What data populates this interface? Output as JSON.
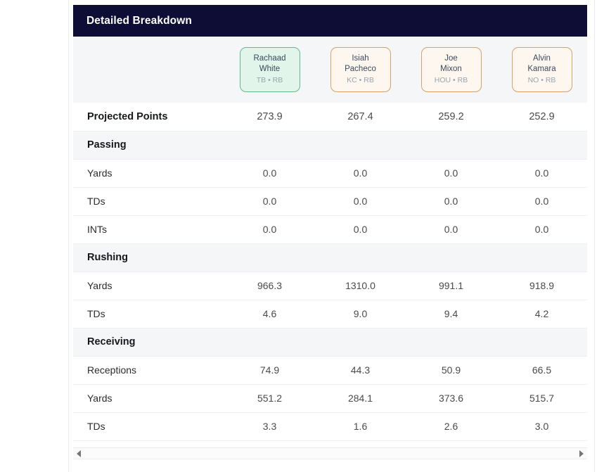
{
  "card": {
    "title": "Detailed Breakdown"
  },
  "scrollbar": {
    "left_arrow": "left-arrow-icon",
    "right_arrow": "right-arrow-icon"
  },
  "players": [
    {
      "first_name": "Rachaad",
      "last_name": "White",
      "team": "TB",
      "position": "RB",
      "meta": "TB • RB",
      "accent": "green",
      "accent_color": "#63b98d"
    },
    {
      "first_name": "Isiah",
      "last_name": "Pacheco",
      "team": "KC",
      "position": "RB",
      "meta": "KC • RB",
      "accent": "orange",
      "accent_color": "#d6a267"
    },
    {
      "first_name": "Joe",
      "last_name": "Mixon",
      "team": "HOU",
      "position": "RB",
      "meta": "HOU • RB",
      "accent": "orange",
      "accent_color": "#d6a267"
    },
    {
      "first_name": "Alvin",
      "last_name": "Kamara",
      "team": "NO",
      "position": "RB",
      "meta": "NO • RB",
      "accent": "orange",
      "accent_color": "#d6a267"
    }
  ],
  "chart_data": {
    "type": "table",
    "title": "Detailed Breakdown",
    "columns": [
      "",
      "Rachaad White",
      "Isiah Pacheco",
      "Joe Mixon",
      "Alvin Kamara"
    ],
    "rows": [
      {
        "kind": "stat",
        "label": "Projected Points",
        "emphasis": true,
        "values": [
          "273.9",
          "267.4",
          "259.2",
          "252.9"
        ]
      },
      {
        "kind": "section",
        "label": "Passing",
        "values": []
      },
      {
        "kind": "stat",
        "label": "Yards",
        "emphasis": false,
        "values": [
          "0.0",
          "0.0",
          "0.0",
          "0.0"
        ]
      },
      {
        "kind": "stat",
        "label": "TDs",
        "emphasis": false,
        "values": [
          "0.0",
          "0.0",
          "0.0",
          "0.0"
        ]
      },
      {
        "kind": "stat",
        "label": "INTs",
        "emphasis": false,
        "values": [
          "0.0",
          "0.0",
          "0.0",
          "0.0"
        ]
      },
      {
        "kind": "section",
        "label": "Rushing",
        "values": []
      },
      {
        "kind": "stat",
        "label": "Yards",
        "emphasis": false,
        "values": [
          "966.3",
          "1310.0",
          "991.1",
          "918.9"
        ]
      },
      {
        "kind": "stat",
        "label": "TDs",
        "emphasis": false,
        "values": [
          "4.6",
          "9.0",
          "9.4",
          "4.2"
        ]
      },
      {
        "kind": "section",
        "label": "Receiving",
        "values": []
      },
      {
        "kind": "stat",
        "label": "Receptions",
        "emphasis": false,
        "values": [
          "74.9",
          "44.3",
          "50.9",
          "66.5"
        ]
      },
      {
        "kind": "stat",
        "label": "Yards",
        "emphasis": false,
        "values": [
          "551.2",
          "284.1",
          "373.6",
          "515.7"
        ]
      },
      {
        "kind": "stat",
        "label": "TDs",
        "emphasis": false,
        "values": [
          "3.3",
          "1.6",
          "2.6",
          "3.0"
        ]
      }
    ]
  },
  "colors": {
    "header_bg": "#0d0d35",
    "section_bg": "#f5f6f8",
    "accent_green": "#63b98d",
    "accent_orange": "#d6a267",
    "chip_green_bg": "#e2f5ea",
    "chip_orange_bg": "#fdf7f0"
  }
}
